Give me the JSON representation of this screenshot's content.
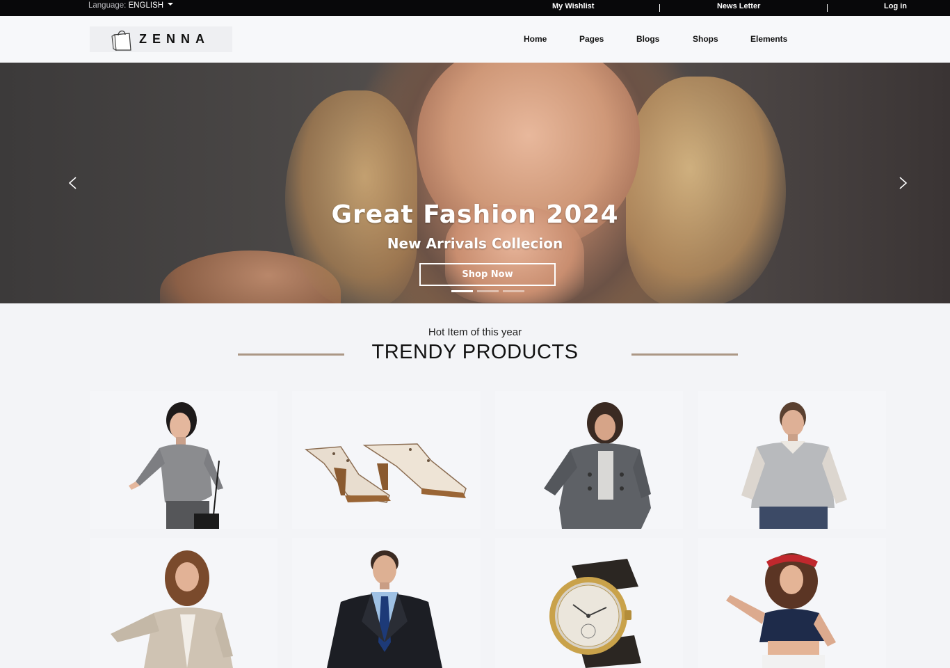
{
  "topbar": {
    "language_label": "Language:",
    "language_value": "ENGLISH",
    "links": [
      "My Wishlist",
      "News Letter",
      "Log in"
    ]
  },
  "header": {
    "brand": "ZENNA",
    "nav": [
      "Home",
      "Pages",
      "Blogs",
      "Shops",
      "Elements"
    ]
  },
  "hero": {
    "title": "Great Fashion 2024",
    "subtitle": "New Arrivals Collecion",
    "button": "Shop Now",
    "slide_count": 3,
    "active_slide": 1
  },
  "section": {
    "kicker": "Hot Item of this year",
    "title": "TRENDY PRODUCTS"
  },
  "products": [
    {
      "subject": "woman-grey-top"
    },
    {
      "subject": "sandals"
    },
    {
      "subject": "woman-grey-coat"
    },
    {
      "subject": "man-grey-sweater"
    },
    {
      "subject": "woman-cardigan"
    },
    {
      "subject": "man-suit"
    },
    {
      "subject": "gold-watch"
    },
    {
      "subject": "woman-red-bandana"
    }
  ],
  "colors": {
    "topbar_bg": "#08080a",
    "page_bg": "#f3f4f7",
    "accent_line": "#ab9785"
  }
}
